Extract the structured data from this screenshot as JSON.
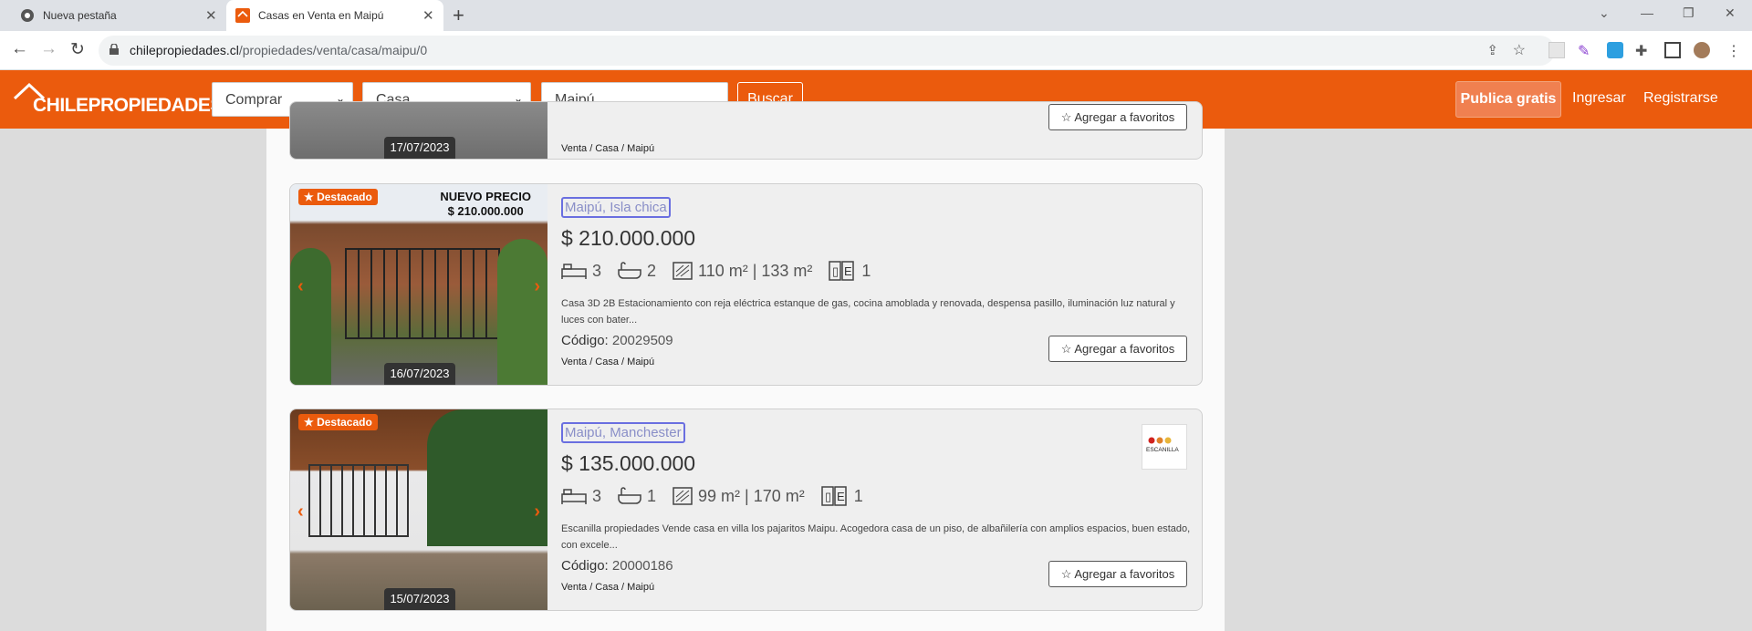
{
  "browser": {
    "tabs": [
      {
        "title": "Nueva pestaña"
      },
      {
        "title": "Casas en Venta en Maipú"
      }
    ],
    "url_domain": "chilepropiedades.cl",
    "url_path": "/propiedades/venta/casa/maipu/0"
  },
  "header": {
    "logo_text": "CHILEPROPIEDADES",
    "operation_select": "Comprar",
    "type_select": "Casa",
    "location_input": "Maipú",
    "search_button": "Buscar",
    "publish_button": "Publica gratis",
    "login_link": "Ingresar",
    "register_link": "Registrarse",
    "brand_color": "#eb5b0d"
  },
  "listings": [
    {
      "date": "17/07/2023",
      "crumb": "Venta / Casa / Maipú",
      "fav_label": "Agregar a favoritos"
    },
    {
      "badge": "Destacado",
      "promo_line1": "NUEVO PRECIO",
      "promo_line2": "$ 210.000.000",
      "date": "16/07/2023",
      "location": "Maipú, Isla chica",
      "price": "$ 210.000.000",
      "beds": "3",
      "baths": "2",
      "area": "110 m² | 133 m²",
      "parking": "1",
      "description": "Casa 3D 2B Estacionamiento con reja eléctrica estanque de gas, cocina amoblada y renovada, despensa pasillo, iluminación luz natural y luces con bater...",
      "code_label": "Código:",
      "code": "20029509",
      "crumb": "Venta / Casa / Maipú",
      "fav_label": "Agregar a favoritos"
    },
    {
      "badge": "Destacado",
      "date": "15/07/2023",
      "location": "Maipú, Manchester",
      "price": "$ 135.000.000",
      "beds": "3",
      "baths": "1",
      "area": "99 m² | 170 m²",
      "parking": "1",
      "description": "Escanilla propiedades Vende casa en villa los pajaritos Maipu. Acogedora casa de un piso, de albañilería con amplios espacios, buen estado, con excele...",
      "code_label": "Código:",
      "code": "20000186",
      "crumb": "Venta / Casa / Maipú",
      "fav_label": "Agregar a favoritos",
      "agency_logo": "ESCANILLA"
    }
  ]
}
